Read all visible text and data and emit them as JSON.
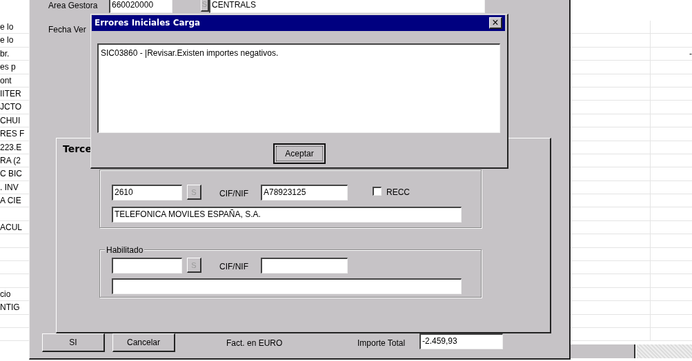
{
  "background_sheet": {
    "left_rows": [
      {
        "text": "e lo"
      },
      {
        "text": "e lo"
      },
      {
        "text": "br."
      },
      {
        "text": "es p"
      },
      {
        "text": "ont"
      },
      {
        "text": "IITER"
      },
      {
        "text": "JCTO"
      },
      {
        "text": "CHUI"
      },
      {
        "text": "RES F"
      },
      {
        "text": "223.E"
      },
      {
        "text": "RA (2"
      },
      {
        "text": "C BIC"
      },
      {
        "text": ". INV"
      },
      {
        "text": "A CIE"
      },
      {},
      {
        "text": "ACUL"
      },
      {},
      {},
      {},
      {},
      {
        "text": "cio"
      },
      {
        "text": "NTIG"
      },
      {},
      {}
    ],
    "right_rows": [
      {},
      {},
      {
        "column_2": "-"
      },
      {},
      {},
      {},
      {},
      {},
      {},
      {},
      {},
      {},
      {},
      {},
      {},
      {},
      {},
      {},
      {},
      {},
      {},
      {},
      {},
      {}
    ]
  },
  "form": {
    "area_gestora": {
      "label": "Area Gestora",
      "code": "660020000",
      "lookup": "S",
      "name": "CENTRALS"
    },
    "fecha_label": "Fecha Ver",
    "group_title": "Terce",
    "tercero": {
      "code": "2610",
      "lookup": "S",
      "cif_label": "CIF/NIF",
      "cif": "A78923125",
      "recc": {
        "label": "RECC",
        "checked": false
      },
      "name": "TELEFONICA MOVILES ESPAÑA, S.A."
    },
    "habilitado": {
      "title": "Habilitado",
      "lookup": "S",
      "cif_label": "CIF/NIF"
    },
    "buttons": [
      "SI",
      "Cancelar"
    ],
    "currency_note": "Fact. en EURO",
    "total_label": "Importe Total",
    "total": "-2.459,93"
  },
  "dialog": {
    "title": "Errores Iniciales Carga",
    "close": "×",
    "message": "SIC03860 - |Revisar.Existen importes negativos.",
    "button": "Aceptar"
  }
}
